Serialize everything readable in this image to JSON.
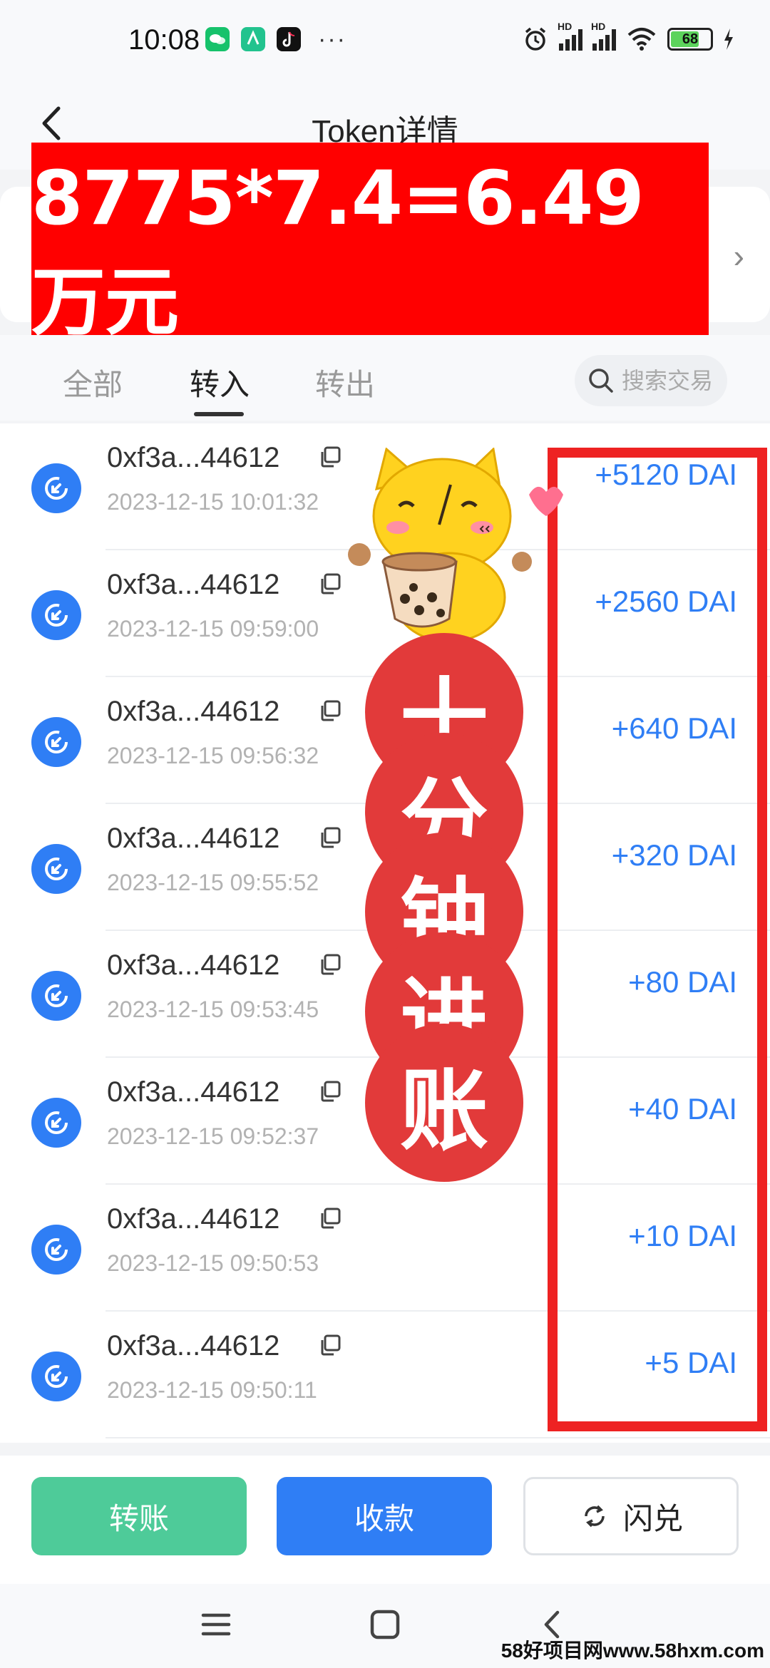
{
  "status_bar": {
    "time": "10:08",
    "dots": "···",
    "battery": "68"
  },
  "header": {
    "title": "Token详情"
  },
  "banner": {
    "text": "8775*7.4=6.49万元"
  },
  "tabs": [
    {
      "label": "全部",
      "active": false
    },
    {
      "label": "转入",
      "active": true
    },
    {
      "label": "转出",
      "active": false
    }
  ],
  "search": {
    "placeholder": "搜索交易"
  },
  "transactions": [
    {
      "address": "0xf3a...44612",
      "time": "2023-12-15 10:01:32",
      "amount": "+5120 DAI"
    },
    {
      "address": "0xf3a...44612",
      "time": "2023-12-15 09:59:00",
      "amount": "+2560 DAI"
    },
    {
      "address": "0xf3a...44612",
      "time": "2023-12-15 09:56:32",
      "amount": "+640 DAI"
    },
    {
      "address": "0xf3a...44612",
      "time": "2023-12-15 09:55:52",
      "amount": "+320 DAI"
    },
    {
      "address": "0xf3a...44612",
      "time": "2023-12-15 09:53:45",
      "amount": "+80 DAI"
    },
    {
      "address": "0xf3a...44612",
      "time": "2023-12-15 09:52:37",
      "amount": "+40 DAI"
    },
    {
      "address": "0xf3a...44612",
      "time": "2023-12-15 09:50:53",
      "amount": "+10 DAI"
    },
    {
      "address": "0xf3a...44612",
      "time": "2023-12-15 09:50:11",
      "amount": "+5 DAI"
    }
  ],
  "sticker": {
    "chars": [
      "十",
      "分",
      "钟",
      "进",
      "账"
    ]
  },
  "actions": {
    "transfer": "转账",
    "receive": "收款",
    "swap": "闪兑"
  },
  "watermark": "58好项目网www.58hxm.com",
  "colors": {
    "accent": "#2f7ef5",
    "green": "#4ecb99",
    "red": "#ff0000"
  }
}
